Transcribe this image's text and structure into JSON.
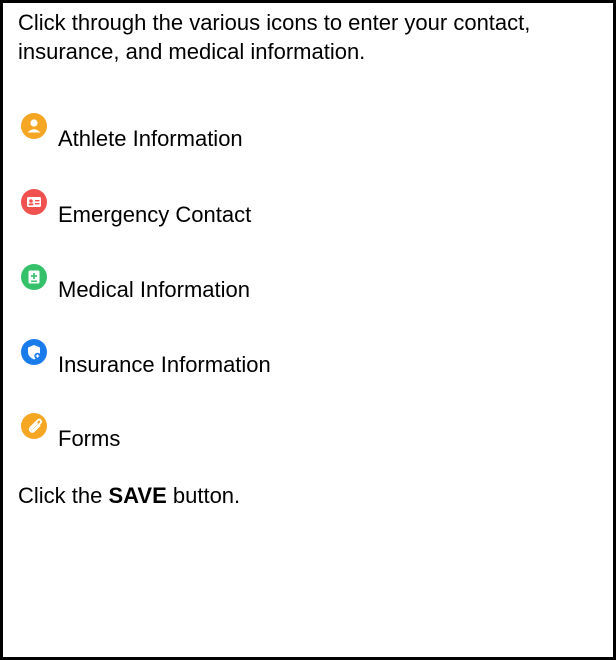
{
  "instructions": {
    "intro": "Click through the various icons to enter your contact, insurance, and medical information.",
    "save_prefix": "Click the ",
    "save_strong": "SAVE",
    "save_suffix": " button."
  },
  "items": [
    {
      "label": "Athlete Information",
      "icon": "athlete-icon",
      "color": "#F5A623"
    },
    {
      "label": "Emergency Contact",
      "icon": "contact-card-icon",
      "color": "#F0524F"
    },
    {
      "label": "Medical Information",
      "icon": "medical-kit-icon",
      "color": "#35C06A"
    },
    {
      "label": "Insurance Information",
      "icon": "insurance-shield-icon",
      "color": "#1A7CEB"
    },
    {
      "label": "Forms",
      "icon": "paperclip-icon",
      "color": "#F5A623"
    }
  ]
}
